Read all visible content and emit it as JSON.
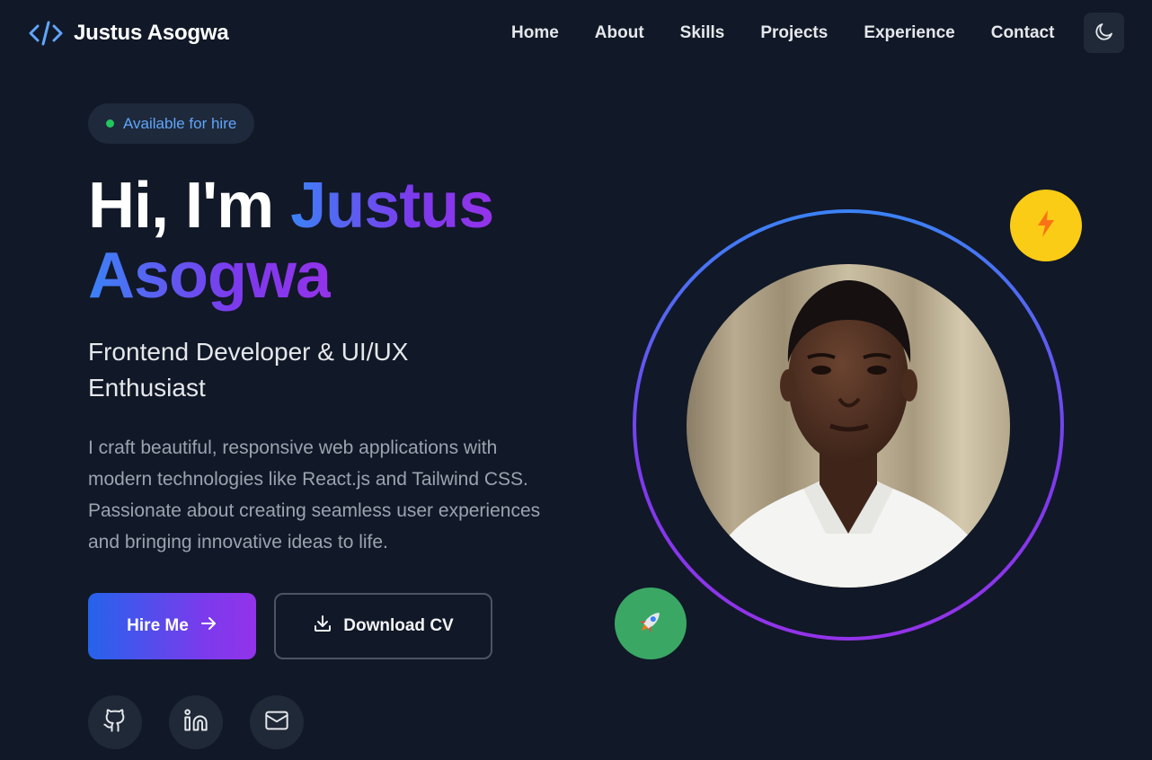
{
  "brand": {
    "name": "Justus Asogwa",
    "icon": "code-icon",
    "icon_color": "#60a5fa"
  },
  "nav": {
    "links": [
      "Home",
      "About",
      "Skills",
      "Projects",
      "Experience",
      "Contact"
    ],
    "theme_toggle_icon": "moon-icon"
  },
  "hero": {
    "badge": "Available for hire",
    "greeting": "Hi, I'm",
    "name_first": "Justus",
    "name_last": "Asogwa",
    "subtitle": "Frontend Developer & UI/UX Enthusiast",
    "description": "I craft beautiful, responsive web applications with modern technologies like React.js and Tailwind CSS. Passionate about creating seamless user experiences and bringing innovative ideas to life.",
    "hire_label": "Hire Me",
    "cv_label": "Download CV"
  },
  "socials": [
    {
      "name": "github-icon"
    },
    {
      "name": "linkedin-icon"
    },
    {
      "name": "mail-icon"
    }
  ],
  "colors": {
    "background": "#111827",
    "accent_blue": "#3b82f6",
    "accent_purple": "#9333ea",
    "badge_dot": "#22c55e",
    "bolt_bg": "#facc15",
    "rocket_bg": "#3aa864"
  }
}
